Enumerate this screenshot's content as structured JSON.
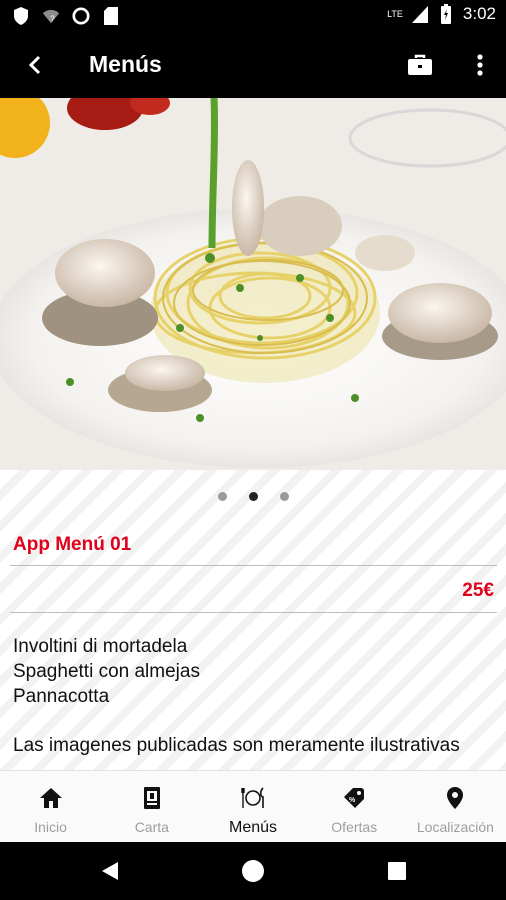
{
  "status_bar": {
    "time": "3:02",
    "network": "LTE",
    "icons": [
      "shield-icon",
      "wifi-question-icon",
      "circle-icon",
      "sd-card-icon",
      "signal-icon",
      "battery-icon"
    ]
  },
  "app_bar": {
    "title": "Menús",
    "icons": [
      "back-arrow-icon",
      "briefcase-icon",
      "more-vert-icon"
    ]
  },
  "carousel": {
    "slide_count": 3,
    "active_index": 1
  },
  "menu": {
    "title": "App Menú 01",
    "price": "25€",
    "items": [
      "Involtini di mortadela",
      "Spaghetti con almejas",
      "Pannacotta"
    ],
    "note": "Las imagenes publicadas son meramente ilustrativas"
  },
  "bottom_nav": {
    "items": [
      {
        "label": "Inicio",
        "icon": "home-icon"
      },
      {
        "label": "Carta",
        "icon": "menu-book-icon"
      },
      {
        "label": "Menús",
        "icon": "plate-cutlery-icon"
      },
      {
        "label": "Ofertas",
        "icon": "offer-tag-icon"
      },
      {
        "label": "Localización",
        "icon": "location-pin-icon"
      }
    ],
    "active_index": 2
  },
  "colors": {
    "accent_red": "#e0001a",
    "bar_black": "#000000"
  }
}
